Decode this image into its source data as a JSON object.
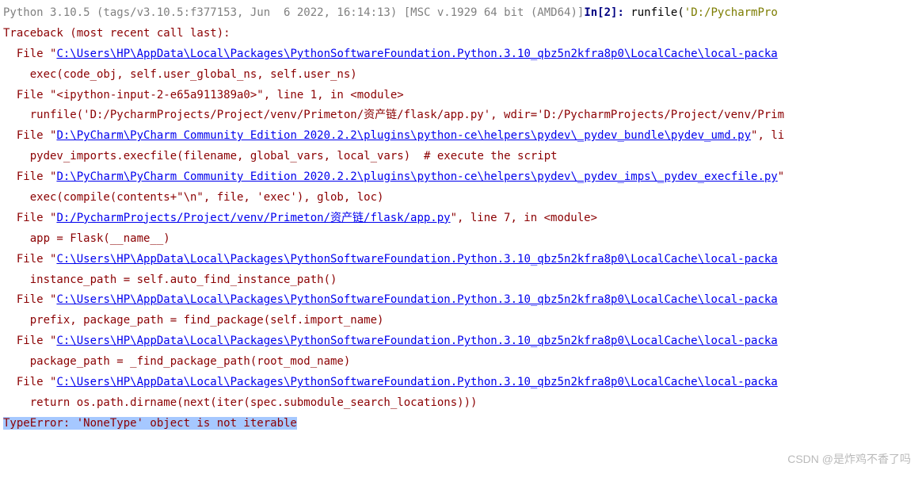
{
  "header": {
    "version_line": "Python 3.10.5 (tags/v3.10.5:f377153, Jun  6 2022, 16:14:13) [MSC v.1929 64 bit (AMD64)]",
    "prompt": "In[2]: ",
    "runfile_prefix": "runfile(",
    "runfile_arg_trunc": "'D:/PycharmPro"
  },
  "traceback_header": "Traceback (most recent call last):",
  "frames": [
    {
      "prefix": "  File \"",
      "link": "C:\\Users\\HP\\AppData\\Local\\Packages\\PythonSoftwareFoundation.Python.3.10_qbz5n2kfra8p0\\LocalCache\\local-packa",
      "suffix": "",
      "code": "    exec(code_obj, self.user_global_ns, self.user_ns)"
    },
    {
      "prefix": "  File \"<ipython-input-2-e65a911389a0>\", line 1, in <module>",
      "link": "",
      "suffix": "",
      "code": "    runfile('D:/PycharmProjects/Project/venv/Primeton/资产链/flask/app.py', wdir='D:/PycharmProjects/Project/venv/Prim"
    },
    {
      "prefix": "  File \"",
      "link": "D:\\PyCharm\\PyCharm Community Edition 2020.2.2\\plugins\\python-ce\\helpers\\pydev\\_pydev_bundle\\pydev_umd.py",
      "suffix": "\", li",
      "code": "    pydev_imports.execfile(filename, global_vars, local_vars)  # execute the script"
    },
    {
      "prefix": "  File \"",
      "link": "D:\\PyCharm\\PyCharm Community Edition 2020.2.2\\plugins\\python-ce\\helpers\\pydev\\_pydev_imps\\_pydev_execfile.py",
      "suffix": "\"",
      "code": "    exec(compile(contents+\"\\n\", file, 'exec'), glob, loc)"
    },
    {
      "prefix": "  File \"",
      "link": "D:/PycharmProjects/Project/venv/Primeton/资产链/flask/app.py",
      "suffix": "\", line 7, in <module>",
      "code": "    app = Flask(__name__)"
    },
    {
      "prefix": "  File \"",
      "link": "C:\\Users\\HP\\AppData\\Local\\Packages\\PythonSoftwareFoundation.Python.3.10_qbz5n2kfra8p0\\LocalCache\\local-packa",
      "suffix": "",
      "code": "    instance_path = self.auto_find_instance_path()"
    },
    {
      "prefix": "  File \"",
      "link": "C:\\Users\\HP\\AppData\\Local\\Packages\\PythonSoftwareFoundation.Python.3.10_qbz5n2kfra8p0\\LocalCache\\local-packa",
      "suffix": "",
      "code": "    prefix, package_path = find_package(self.import_name)"
    },
    {
      "prefix": "  File \"",
      "link": "C:\\Users\\HP\\AppData\\Local\\Packages\\PythonSoftwareFoundation.Python.3.10_qbz5n2kfra8p0\\LocalCache\\local-packa",
      "suffix": "",
      "code": "    package_path = _find_package_path(root_mod_name)"
    },
    {
      "prefix": "  File \"",
      "link": "C:\\Users\\HP\\AppData\\Local\\Packages\\PythonSoftwareFoundation.Python.3.10_qbz5n2kfra8p0\\LocalCache\\local-packa",
      "suffix": "",
      "code": "    return os.path.dirname(next(iter(spec.submodule_search_locations)))"
    }
  ],
  "error": "TypeError: 'NoneType' object is not iterable",
  "watermark": "CSDN @是炸鸡不香了吗"
}
